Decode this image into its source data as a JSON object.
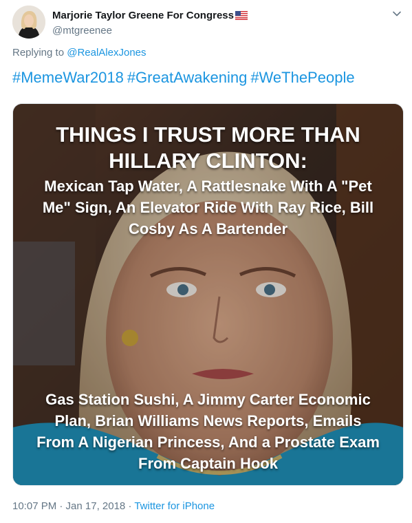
{
  "tweet": {
    "author_name": "Marjorie Taylor Greene For Congress",
    "author_handle": "@mtgreenee",
    "flag_icon": "us-flag-emoji",
    "menu_icon": "chevron-down-icon",
    "reply_prefix": "Replying to",
    "reply_mention": "@RealAlexJones",
    "hashtags": [
      "#MemeWar2018",
      "#GreatAwakening",
      "#WeThePeople"
    ],
    "meme": {
      "heading": "THINGS I TRUST MORE THAN HILLARY CLINTON:",
      "top_text": "Mexican Tap Water, A Rattlesnake With A \"Pet Me\" Sign, An Elevator Ride With Ray Rice, Bill Cosby As A Bartender",
      "bottom_text": "Gas Station Sushi, A Jimmy Carter Economic Plan, Brian Williams News Reports, Emails From A Nigerian Princess, And a Prostate Exam From Captain Hook"
    },
    "timestamp": "10:07 PM · Jan 17, 2018 ·",
    "source": "Twitter for iPhone"
  },
  "colors": {
    "link": "#1b95e0",
    "secondary_text": "#657786",
    "primary_text": "#14171a"
  }
}
